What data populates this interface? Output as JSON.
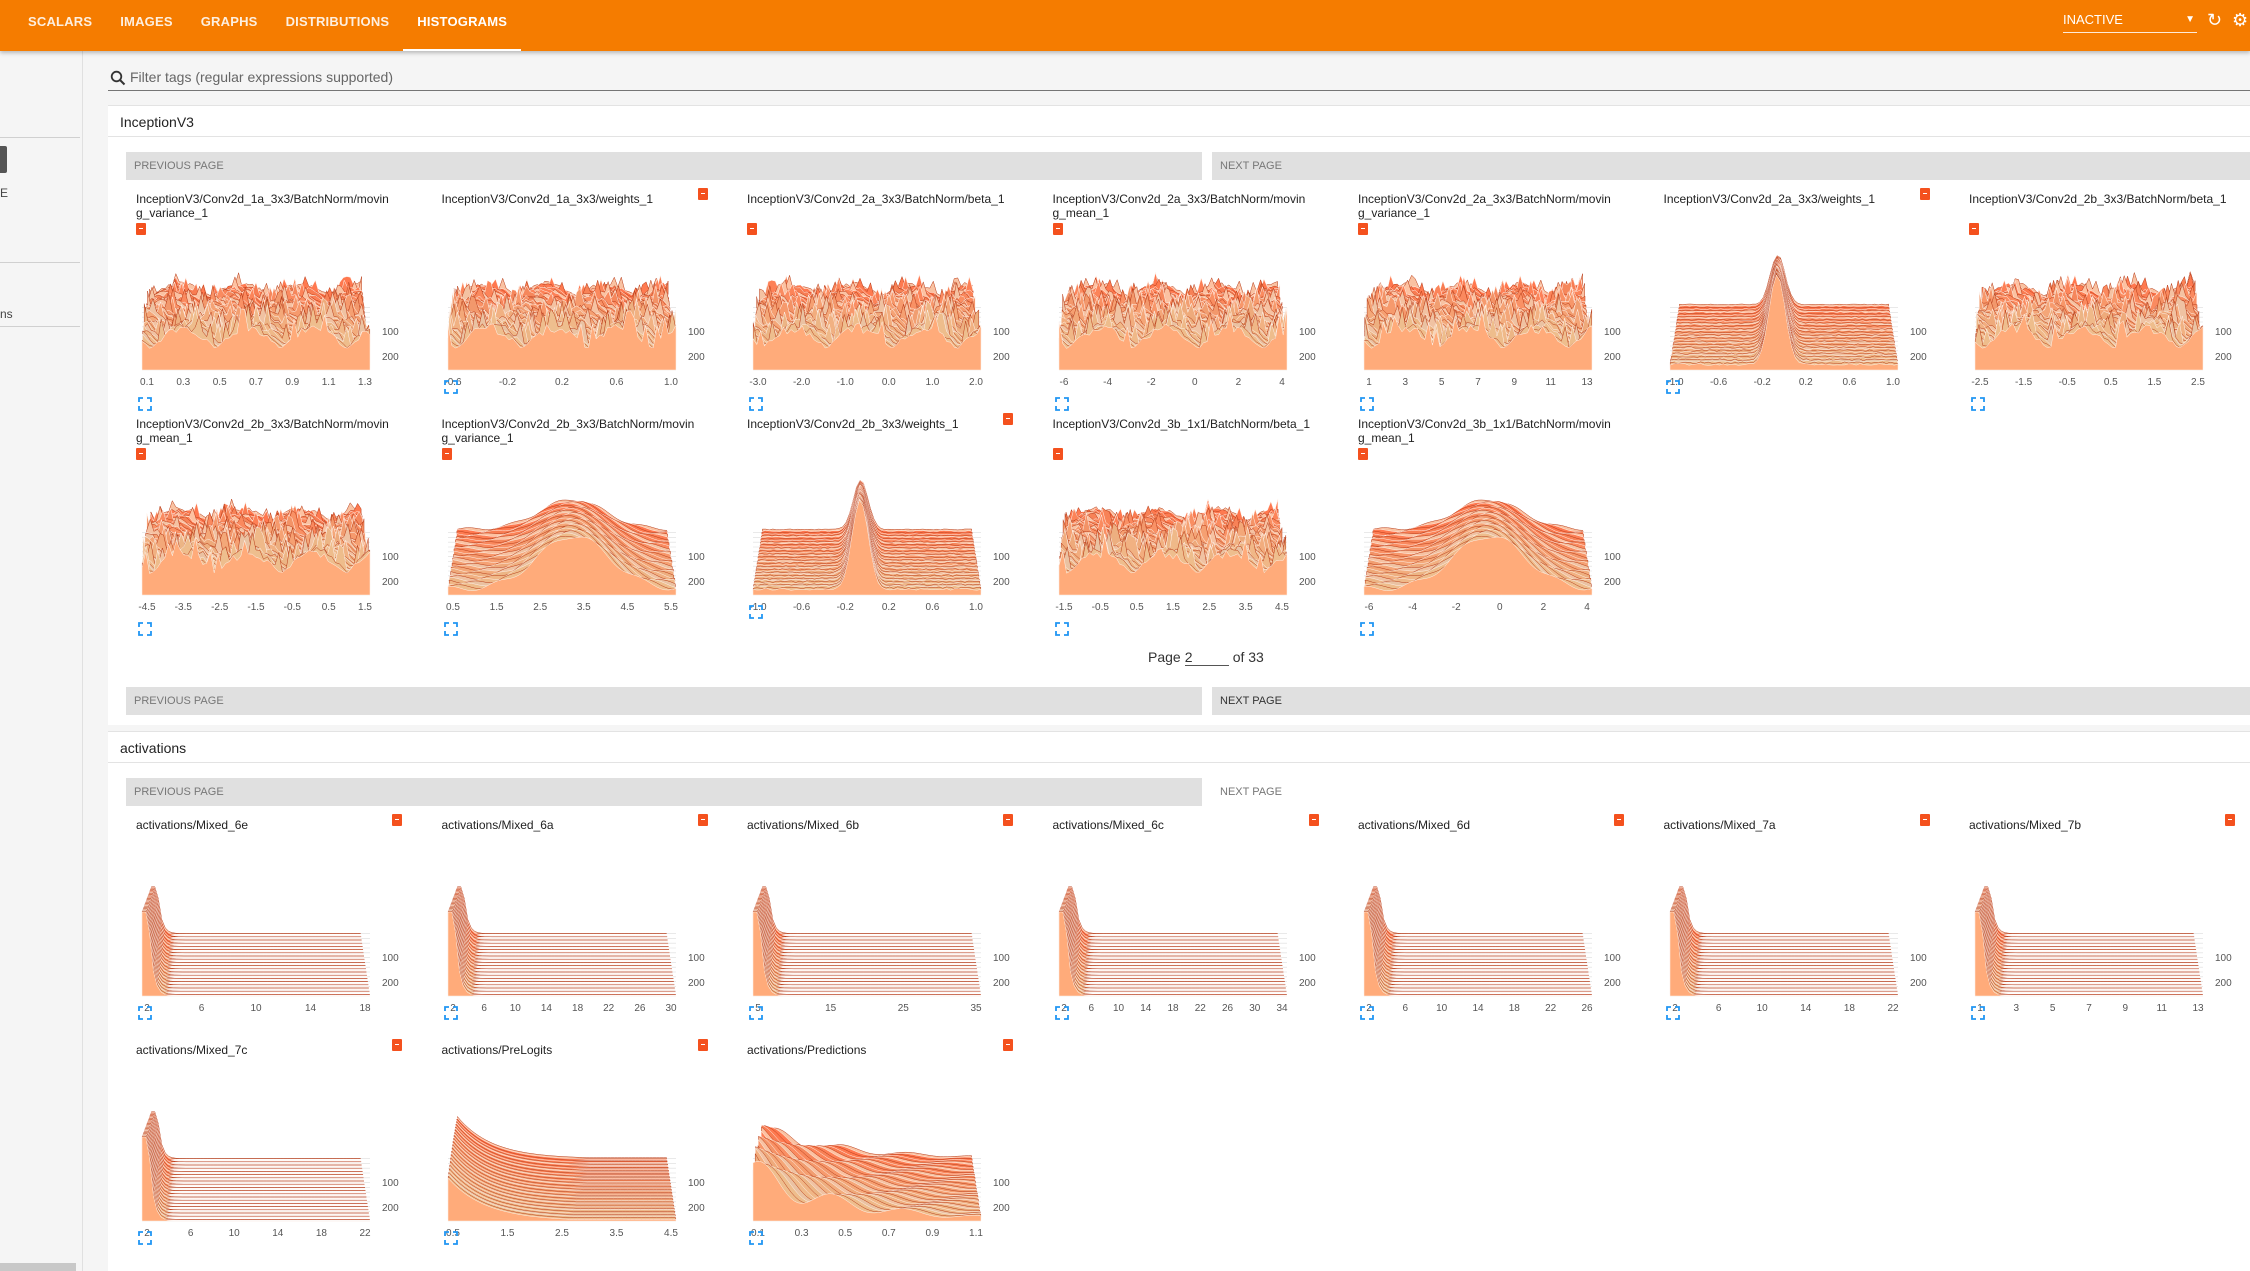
{
  "topbar": {
    "tabs": [
      "SCALARS",
      "IMAGES",
      "GRAPHS",
      "DISTRIBUTIONS",
      "HISTOGRAMS"
    ],
    "active_tab": 4,
    "run_select": "INACTIVE",
    "colors": {
      "bar": "#f57c00",
      "text": "#ffffff"
    },
    "icons": {
      "refresh": "refresh-icon",
      "settings": "gear-icon"
    }
  },
  "sidebar": {
    "texts": [
      "E",
      "ns"
    ]
  },
  "filter": {
    "placeholder": "Filter tags (regular expressions supported)",
    "icon": "search-icon"
  },
  "pager": {
    "previous": "PREVIOUS PAGE",
    "next": "NEXT PAGE",
    "page_label": "Page",
    "page_value": "2",
    "of_label": "of 33"
  },
  "categories": [
    {
      "name": "InceptionV3",
      "cards": [
        {
          "title": "InceptionV3/Conv2d_1a_3x3/BatchNorm/moving_variance_1",
          "ticks": [
            "0.1",
            "0.3",
            "0.5",
            "0.7",
            "0.9",
            "1.1",
            "1.3"
          ],
          "ylabels": [
            "100",
            "200"
          ]
        },
        {
          "title": "InceptionV3/Conv2d_1a_3x3/weights_1",
          "ticks": [
            "-0.6",
            "-0.2",
            "0.2",
            "0.6",
            "1.0"
          ],
          "ylabels": [
            "100",
            "200"
          ]
        },
        {
          "title": "InceptionV3/Conv2d_2a_3x3/BatchNorm/beta_1",
          "ticks": [
            "-3.0",
            "-2.0",
            "-1.0",
            "0.0",
            "1.0",
            "2.0"
          ],
          "ylabels": [
            "100",
            "200"
          ]
        },
        {
          "title": "InceptionV3/Conv2d_2a_3x3/BatchNorm/moving_mean_1",
          "ticks": [
            "-6",
            "-4",
            "-2",
            "0",
            "2",
            "4"
          ],
          "ylabels": [
            "100",
            "200"
          ]
        },
        {
          "title": "InceptionV3/Conv2d_2a_3x3/BatchNorm/moving_variance_1",
          "ticks": [
            "1",
            "3",
            "5",
            "7",
            "9",
            "11",
            "13"
          ],
          "ylabels": [
            "100",
            "200"
          ]
        },
        {
          "title": "InceptionV3/Conv2d_2a_3x3/weights_1",
          "ticks": [
            "-1.0",
            "-0.6",
            "-0.2",
            "0.2",
            "0.6",
            "1.0"
          ],
          "ylabels": [
            "100",
            "200"
          ]
        },
        {
          "title": "InceptionV3/Conv2d_2b_3x3/BatchNorm/beta_1",
          "ticks": [
            "-2.5",
            "-1.5",
            "-0.5",
            "0.5",
            "1.5",
            "2.5"
          ],
          "ylabels": [
            "100",
            "200"
          ]
        },
        {
          "title": "InceptionV3/Conv2d_2b_3x3/BatchNorm/moving_mean_1",
          "ticks": [
            "-4.5",
            "-3.5",
            "-2.5",
            "-1.5",
            "-0.5",
            "0.5",
            "1.5"
          ],
          "ylabels": [
            "100",
            "200"
          ]
        },
        {
          "title": "InceptionV3/Conv2d_2b_3x3/BatchNorm/moving_variance_1",
          "ticks": [
            "0.5",
            "1.5",
            "2.5",
            "3.5",
            "4.5",
            "5.5"
          ],
          "ylabels": [
            "100",
            "200"
          ]
        },
        {
          "title": "InceptionV3/Conv2d_2b_3x3/weights_1",
          "ticks": [
            "-1.0",
            "-0.6",
            "-0.2",
            "0.2",
            "0.6",
            "1.0"
          ],
          "ylabels": [
            "100",
            "200"
          ]
        },
        {
          "title": "InceptionV3/Conv2d_3b_1x1/BatchNorm/beta_1",
          "ticks": [
            "-1.5",
            "-0.5",
            "0.5",
            "1.5",
            "2.5",
            "3.5",
            "4.5"
          ],
          "ylabels": [
            "100",
            "200"
          ]
        },
        {
          "title": "InceptionV3/Conv2d_3b_1x1/BatchNorm/moving_mean_1",
          "ticks": [
            "-6",
            "-4",
            "-2",
            "0",
            "2",
            "4"
          ],
          "ylabels": [
            "100",
            "200"
          ]
        }
      ]
    },
    {
      "name": "activations",
      "cards": [
        {
          "title": "activations/Mixed_6e",
          "ticks": [
            "2",
            "6",
            "10",
            "14",
            "18"
          ],
          "ylabels": [
            "100",
            "200"
          ]
        },
        {
          "title": "activations/Mixed_6a",
          "ticks": [
            "2",
            "6",
            "10",
            "14",
            "18",
            "22",
            "26",
            "30"
          ],
          "ylabels": [
            "100",
            "200"
          ]
        },
        {
          "title": "activations/Mixed_6b",
          "ticks": [
            "5",
            "15",
            "25",
            "35"
          ],
          "ylabels": [
            "100",
            "200"
          ]
        },
        {
          "title": "activations/Mixed_6c",
          "ticks": [
            "2",
            "6",
            "10",
            "14",
            "18",
            "22",
            "26",
            "30",
            "34"
          ],
          "ylabels": [
            "100",
            "200"
          ]
        },
        {
          "title": "activations/Mixed_6d",
          "ticks": [
            "2",
            "6",
            "10",
            "14",
            "18",
            "22",
            "26"
          ],
          "ylabels": [
            "100",
            "200"
          ]
        },
        {
          "title": "activations/Mixed_7a",
          "ticks": [
            "2",
            "6",
            "10",
            "14",
            "18",
            "22"
          ],
          "ylabels": [
            "100",
            "200"
          ]
        },
        {
          "title": "activations/Mixed_7b",
          "ticks": [
            "1",
            "3",
            "5",
            "7",
            "9",
            "11",
            "13"
          ],
          "ylabels": [
            "100",
            "200"
          ]
        },
        {
          "title": "activations/Mixed_7c",
          "ticks": [
            "2",
            "6",
            "10",
            "14",
            "18",
            "22"
          ],
          "ylabels": [
            "100",
            "200"
          ]
        },
        {
          "title": "activations/PreLogits",
          "ticks": [
            "0.5",
            "1.5",
            "2.5",
            "3.5",
            "4.5"
          ],
          "ylabels": [
            "100",
            "200"
          ]
        },
        {
          "title": "activations/Predictions",
          "ticks": [
            "0.1",
            "0.3",
            "0.5",
            "0.7",
            "0.9",
            "1.1"
          ],
          "ylabels": [
            "100",
            "200"
          ]
        }
      ]
    }
  ],
  "colors": {
    "histogram_dark": "#c4411a",
    "histogram_light": "#ffd9c4",
    "accent": "#f57c00",
    "expand": "#2196f3"
  }
}
